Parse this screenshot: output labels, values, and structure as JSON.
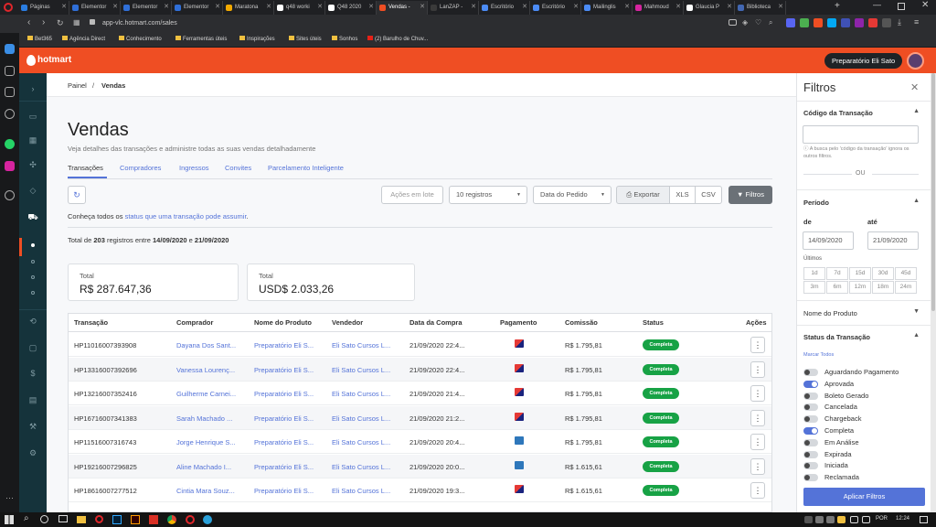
{
  "browser": {
    "tabs": [
      {
        "label": "Páginas",
        "color": "#2a7de1"
      },
      {
        "label": "Elementor",
        "color": "#2f6fd8"
      },
      {
        "label": "Elementor",
        "color": "#2f6fd8"
      },
      {
        "label": "Elementor",
        "color": "#2f6fd8"
      },
      {
        "label": "Maratona",
        "color": "#f2a900"
      },
      {
        "label": "q48 worki",
        "color": "#ffffff"
      },
      {
        "label": "Q48 2020",
        "color": "#ffffff"
      },
      {
        "label": "Vendas -",
        "color": "#ef4e23"
      },
      {
        "label": "LanZAP -",
        "color": "#3a3a3a"
      },
      {
        "label": "Escritório",
        "color": "#4b8bf5"
      },
      {
        "label": "Escritório",
        "color": "#4b8bf5"
      },
      {
        "label": "Mailinglis",
        "color": "#4b8bf5"
      },
      {
        "label": "Mahmoud",
        "color": "#d6249f"
      },
      {
        "label": "Glaucia P",
        "color": "#ffffff"
      },
      {
        "label": "Biblioteca",
        "color": "#4267b2"
      }
    ],
    "url": "app-vlc.hotmart.com/sales",
    "bookmarks": [
      "Bet365",
      "Agência Direct",
      "Conhecimento",
      "Ferramentas úteis",
      "Inspirações",
      "Sites úteis",
      "Sonhos",
      "(2) Barulho de Chuv..."
    ]
  },
  "header": {
    "logo": "hotmart",
    "user_button": "Preparatório Eli Sato"
  },
  "breadcrumb": {
    "root": "Painel",
    "sep": "/",
    "current": "Vendas"
  },
  "page": {
    "title": "Vendas",
    "subtitle": "Veja detalhes das transações e administre todas as suas vendas detalhadamente",
    "tabs": [
      "Transações",
      "Compradores",
      "Ingressos",
      "Convites",
      "Parcelamento Inteligente"
    ]
  },
  "toolbar": {
    "bulk_actions": "Ações em lote",
    "per_page": "10 registros",
    "sort": "Data do Pedido",
    "export": "Exportar",
    "xls": "XLS",
    "csv": "CSV",
    "filters": "Filtros"
  },
  "info": {
    "status_prefix": "Conheça todos os",
    "status_link": "status que uma transação pode assumir",
    "status_suffix": ".",
    "summary_prefix": "Total de",
    "summary_count": "203",
    "summary_mid": "registros entre",
    "summary_start": "14/09/2020",
    "summary_and": "e",
    "summary_end": "21/09/2020"
  },
  "totals": [
    {
      "label": "Total",
      "value": "R$ 287.647,36"
    },
    {
      "label": "Total",
      "value": "USD$ 2.033,26"
    }
  ],
  "table": {
    "headers": [
      "Transação",
      "Comprador",
      "Nome do Produto",
      "Vendedor",
      "Data da Compra",
      "Pagamento",
      "Comissão",
      "Status",
      "Ações"
    ],
    "rows": [
      {
        "id": "HP11016007393908",
        "buyer": "Dayana Dos Sant...",
        "product": "Preparatório Eli S...",
        "seller": "Eli Sato Cursos L...",
        "date": "21/09/2020 22:4...",
        "pay": "card",
        "commission": "R$ 1.795,81",
        "status": "Completa"
      },
      {
        "id": "HP13316007392696",
        "buyer": "Vanessa Lourenç...",
        "product": "Preparatório Eli S...",
        "seller": "Eli Sato Cursos L...",
        "date": "21/09/2020 22:4...",
        "pay": "card",
        "commission": "R$ 1.795,81",
        "status": "Completa"
      },
      {
        "id": "HP13216007352416",
        "buyer": "Guilherme Carnei...",
        "product": "Preparatório Eli S...",
        "seller": "Eli Sato Cursos L...",
        "date": "21/09/2020 21:4...",
        "pay": "card",
        "commission": "R$ 1.795,81",
        "status": "Completa"
      },
      {
        "id": "HP16716007341383",
        "buyer": "Sarah Machado ...",
        "product": "Preparatório Eli S...",
        "seller": "Eli Sato Cursos L...",
        "date": "21/09/2020 21:2...",
        "pay": "card",
        "commission": "R$ 1.795,81",
        "status": "Completa"
      },
      {
        "id": "HP11516007316743",
        "buyer": "Jorge Henrique S...",
        "product": "Preparatório Eli S...",
        "seller": "Eli Sato Cursos L...",
        "date": "21/09/2020 20:4...",
        "pay": "amex",
        "commission": "R$ 1.795,81",
        "status": "Completa"
      },
      {
        "id": "HP19216007296825",
        "buyer": "Aline Machado I...",
        "product": "Preparatório Eli S...",
        "seller": "Eli Sato Cursos L...",
        "date": "21/09/2020 20:0...",
        "pay": "amex",
        "commission": "R$ 1.615,61",
        "status": "Completa"
      },
      {
        "id": "HP18616007277512",
        "buyer": "Cintia Mara Souz...",
        "product": "Preparatório Eli S...",
        "seller": "Eli Sato Cursos L...",
        "date": "21/09/2020 19:3...",
        "pay": "card",
        "commission": "R$ 1.615,61",
        "status": "Completa"
      }
    ]
  },
  "filters": {
    "title": "Filtros",
    "transaction_code": "Código da Transação",
    "code_value": "",
    "code_hint": "A busca pelo 'código da transação' ignora os outros filtros.",
    "or": "OU",
    "period": "Período",
    "from_label": "de",
    "to_label": "até",
    "from_value": "14/09/2020",
    "to_value": "21/09/2020",
    "last_label": "Últimos",
    "ranges": [
      "1d",
      "7d",
      "15d",
      "30d",
      "45d",
      "3m",
      "6m",
      "12m",
      "18m",
      "24m"
    ],
    "product_name": "Nome do Produto",
    "status_title": "Status da Transação",
    "select_all": "Marcar Todos",
    "statuses": [
      {
        "label": "Aguardando Pagamento",
        "on": false
      },
      {
        "label": "Aprovada",
        "on": true
      },
      {
        "label": "Boleto Gerado",
        "on": false
      },
      {
        "label": "Cancelada",
        "on": false
      },
      {
        "label": "Chargeback",
        "on": false
      },
      {
        "label": "Completa",
        "on": true
      },
      {
        "label": "Em Análise",
        "on": false
      },
      {
        "label": "Expirada",
        "on": false
      },
      {
        "label": "Iniciada",
        "on": false
      },
      {
        "label": "Reclamada",
        "on": false
      }
    ],
    "apply": "Aplicar Filtros"
  },
  "taskbar": {
    "lang": "POR",
    "time": "12:24"
  },
  "colors": {
    "brand": "#ef4e23",
    "accent": "#5473d8",
    "success": "#17a245",
    "sidebar": "#15333b"
  }
}
